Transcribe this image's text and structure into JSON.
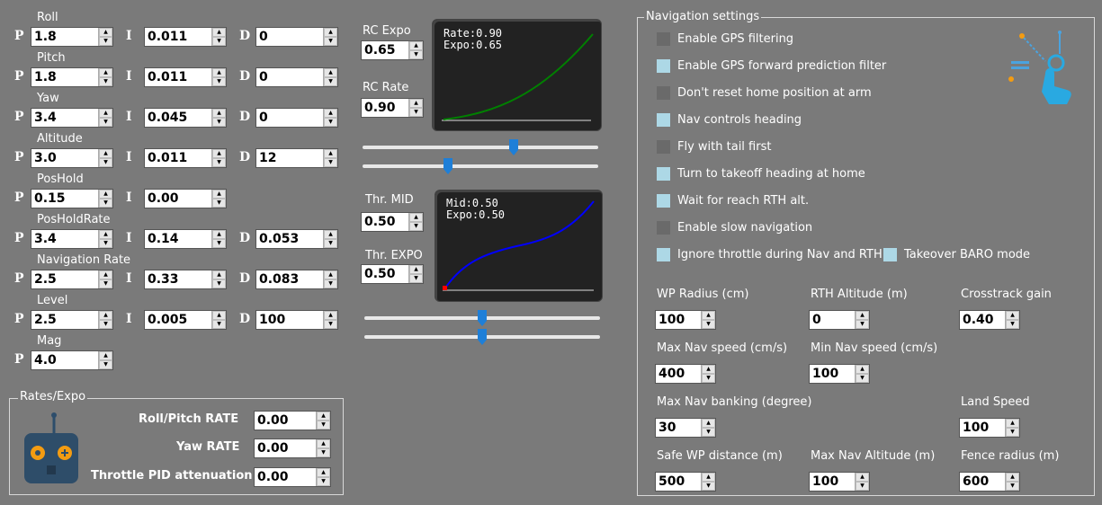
{
  "pid": {
    "rows": [
      {
        "name": "Roll",
        "p": "1.8",
        "i": "0.011",
        "d": "0"
      },
      {
        "name": "Pitch",
        "p": "1.8",
        "i": "0.011",
        "d": "0"
      },
      {
        "name": "Yaw",
        "p": "3.4",
        "i": "0.045",
        "d": "0"
      },
      {
        "name": "Altitude",
        "p": "3.0",
        "i": "0.011",
        "d": "12"
      },
      {
        "name": "PosHold",
        "p": "0.15",
        "i": "0.00",
        "d": null
      },
      {
        "name": "PosHoldRate",
        "p": "3.4",
        "i": "0.14",
        "d": "0.053"
      },
      {
        "name": "Navigation Rate",
        "p": "2.5",
        "i": "0.33",
        "d": "0.083"
      },
      {
        "name": "Level",
        "p": "2.5",
        "i": "0.005",
        "d": "100"
      },
      {
        "name": "Mag",
        "p": "4.0",
        "i": null,
        "d": null
      }
    ],
    "letters": {
      "p": "P",
      "i": "I",
      "d": "D"
    }
  },
  "rates": {
    "title": "Rates/Expo",
    "roll_pitch_label": "Roll/Pitch RATE",
    "roll_pitch": "0.00",
    "yaw_label": "Yaw RATE",
    "yaw": "0.00",
    "tpa_label": "Throttle PID attenuation",
    "tpa": "0.00"
  },
  "rc": {
    "expo_label": "RC Expo",
    "expo": "0.65",
    "rate_label": "RC Rate",
    "rate": "0.90",
    "graph_text": "Rate:0.90\nExpo:0.65",
    "slider1_fraction": 0.65,
    "slider2_fraction": 0.36
  },
  "thr": {
    "mid_label": "Thr. MID",
    "mid": "0.50",
    "expo_label": "Thr. EXPO",
    "expo": "0.50",
    "graph_text": "Mid:0.50\nExpo:0.50",
    "slider1_fraction": 0.5,
    "slider2_fraction": 0.5
  },
  "nav": {
    "title": "Navigation settings",
    "checks": [
      {
        "label": "Enable GPS filtering",
        "checked": false
      },
      {
        "label": "Enable GPS forward prediction filter",
        "checked": true
      },
      {
        "label": "Don't reset home position at arm",
        "checked": false
      },
      {
        "label": "Nav controls heading",
        "checked": true
      },
      {
        "label": "Fly with tail first",
        "checked": false
      },
      {
        "label": "Turn to takeoff heading at home",
        "checked": true
      },
      {
        "label": "Wait for reach RTH alt.",
        "checked": true
      },
      {
        "label": "Enable slow navigation",
        "checked": false
      },
      {
        "label": "Ignore throttle during Nav and RTH",
        "checked": true
      }
    ],
    "takeover": {
      "label": "Takeover BARO mode",
      "checked": true
    },
    "fields": {
      "wp_radius": {
        "label": "WP Radius (cm)",
        "value": "100"
      },
      "rth_alt": {
        "label": "RTH Altitude (m)",
        "value": "0"
      },
      "crosstrack": {
        "label": "Crosstrack gain",
        "value": "0.40"
      },
      "max_speed": {
        "label": "Max Nav speed (cm/s)",
        "value": "400"
      },
      "min_speed": {
        "label": "Min Nav speed (cm/s)",
        "value": "100"
      },
      "max_bank": {
        "label": "Max Nav banking (degree)",
        "value": "30"
      },
      "land_speed": {
        "label": "Land Speed",
        "value": "100"
      },
      "safe_wp": {
        "label": "Safe WP distance (m)",
        "value": "500"
      },
      "max_alt": {
        "label": "Max Nav Altitude (m)",
        "value": "100"
      },
      "fence": {
        "label": "Fence radius (m)",
        "value": "600"
      }
    }
  },
  "colors": {
    "background": "#7a7a7a",
    "checked": "#add8e6",
    "unchecked": "#6a6a6a",
    "expo_curve": "#008000",
    "thr_curve": "#0000ff",
    "slider_thumb": "#1e7fd8"
  }
}
